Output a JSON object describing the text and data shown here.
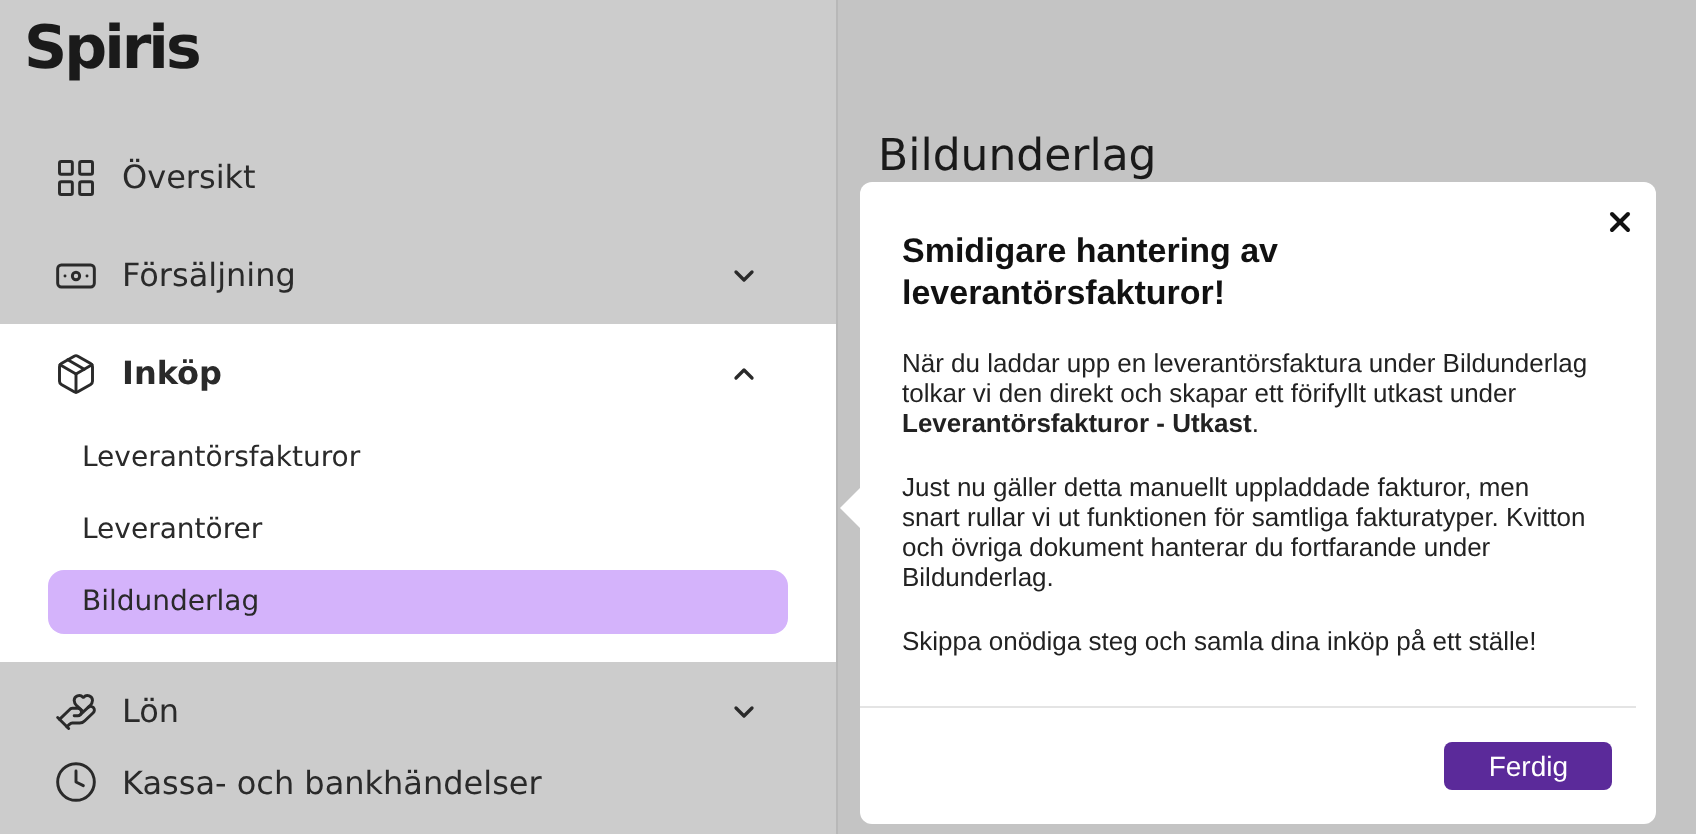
{
  "logo": "Spiris",
  "sidebar": {
    "items": [
      {
        "kind": "link",
        "label": "Översikt"
      },
      {
        "kind": "group",
        "label": "Försäljning",
        "expanded": false
      },
      {
        "kind": "group",
        "label": "Inköp",
        "expanded": true,
        "children": [
          {
            "label": "Leverantörsfakturor",
            "selected": false
          },
          {
            "label": "Leverantörer",
            "selected": false
          },
          {
            "label": "Bildunderlag",
            "selected": true
          }
        ]
      },
      {
        "kind": "group",
        "label": "Lön",
        "expanded": false
      },
      {
        "kind": "link",
        "label": "Kassa- och bankhändelser"
      }
    ]
  },
  "page": {
    "title": "Bildunderlag"
  },
  "popover": {
    "title": "Smidigare hantering av leverantörsfakturor!",
    "paragraphs": [
      "När du laddar upp en leverantörsfaktura under Bildunderlag tolkar vi den direkt och skapar ett förifyllt utkast under **Leverantörsfakturor - Utkast**.",
      "Just nu gäller detta manuellt uppladdade fakturor, men snart rullar vi ut funktionen för samtliga fakturatyper. Kvitton och övriga dokument hanterar du fortfarande under Bildunderlag.",
      "Skippa onödiga steg och samla dina inköp på ett ställe!"
    ],
    "button": "Ferdig"
  }
}
